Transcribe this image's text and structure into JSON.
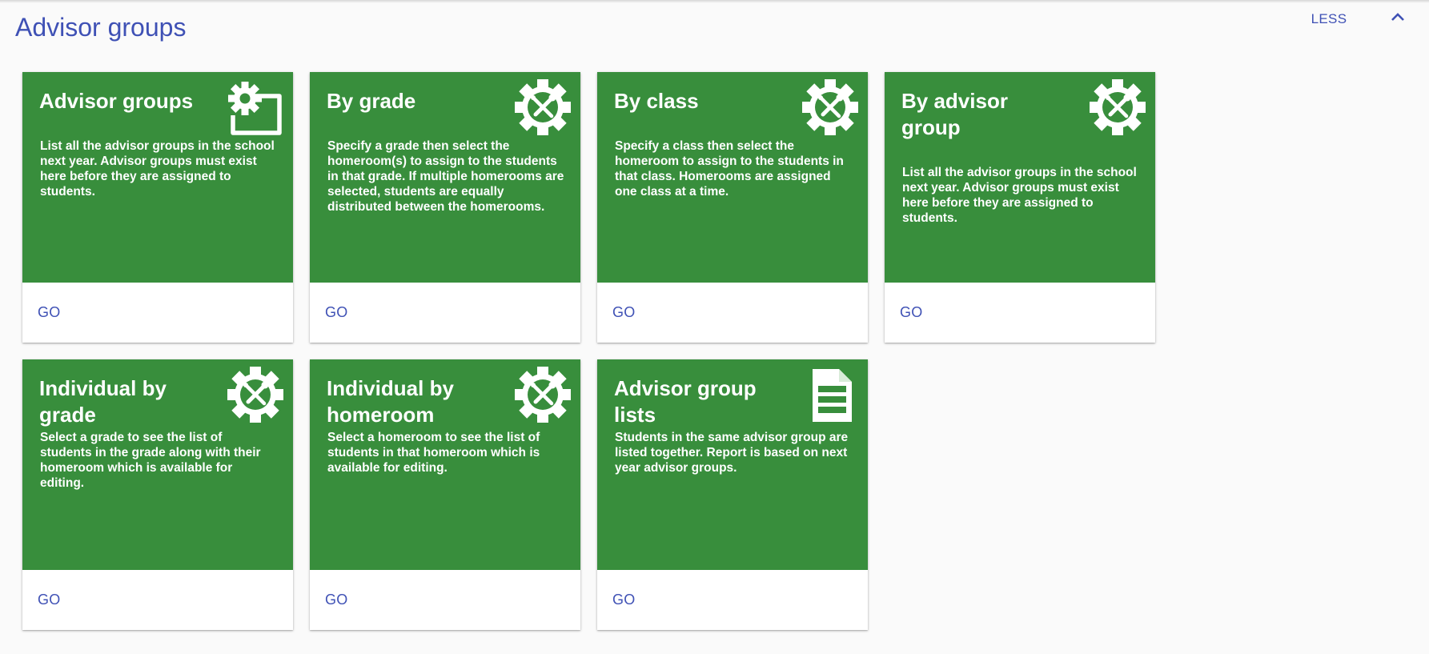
{
  "section": {
    "title": "Advisor groups",
    "toggle_label": "LESS",
    "collapse_icon": "chevron-up-icon"
  },
  "colors": {
    "card_green": "#388e3c",
    "accent_blue": "#3f51b5",
    "background": "#fafafa"
  },
  "cards": [
    {
      "title": "Advisor groups",
      "description": "List all the advisor groups in the school next year. Advisor groups must exist here before they are assigned to students.",
      "icon": "gear-folder-icon",
      "action_label": "GO"
    },
    {
      "title": "By grade",
      "description": "Specify a grade then select the homeroom(s) to assign to the students in that grade. If multiple homerooms are selected, students are equally distributed between the homerooms.",
      "icon": "tools-gear-icon",
      "action_label": "GO"
    },
    {
      "title": "By class",
      "description": "Specify a class then select the homeroom to assign to the students in that class. Homerooms are assigned one class at a time.",
      "icon": "tools-gear-icon",
      "action_label": "GO"
    },
    {
      "title": "By advisor group",
      "description": "List all the advisor groups in the school next year. Advisor groups must exist here before they are assigned to students.",
      "icon": "tools-gear-icon",
      "action_label": "GO"
    },
    {
      "title": "Individual by grade",
      "description": "Select a grade to see the list of students in the grade along with their homeroom which is available for editing.",
      "icon": "tools-gear-icon",
      "action_label": "GO"
    },
    {
      "title": "Individual by homeroom",
      "description": "Select a homeroom to see the list of students in that homeroom which is available for editing.",
      "icon": "tools-gear-icon",
      "action_label": "GO"
    },
    {
      "title": "Advisor group lists",
      "description": "Students in the same advisor group are listed together. Report is based on next year advisor groups.",
      "icon": "document-icon",
      "action_label": "GO"
    }
  ]
}
